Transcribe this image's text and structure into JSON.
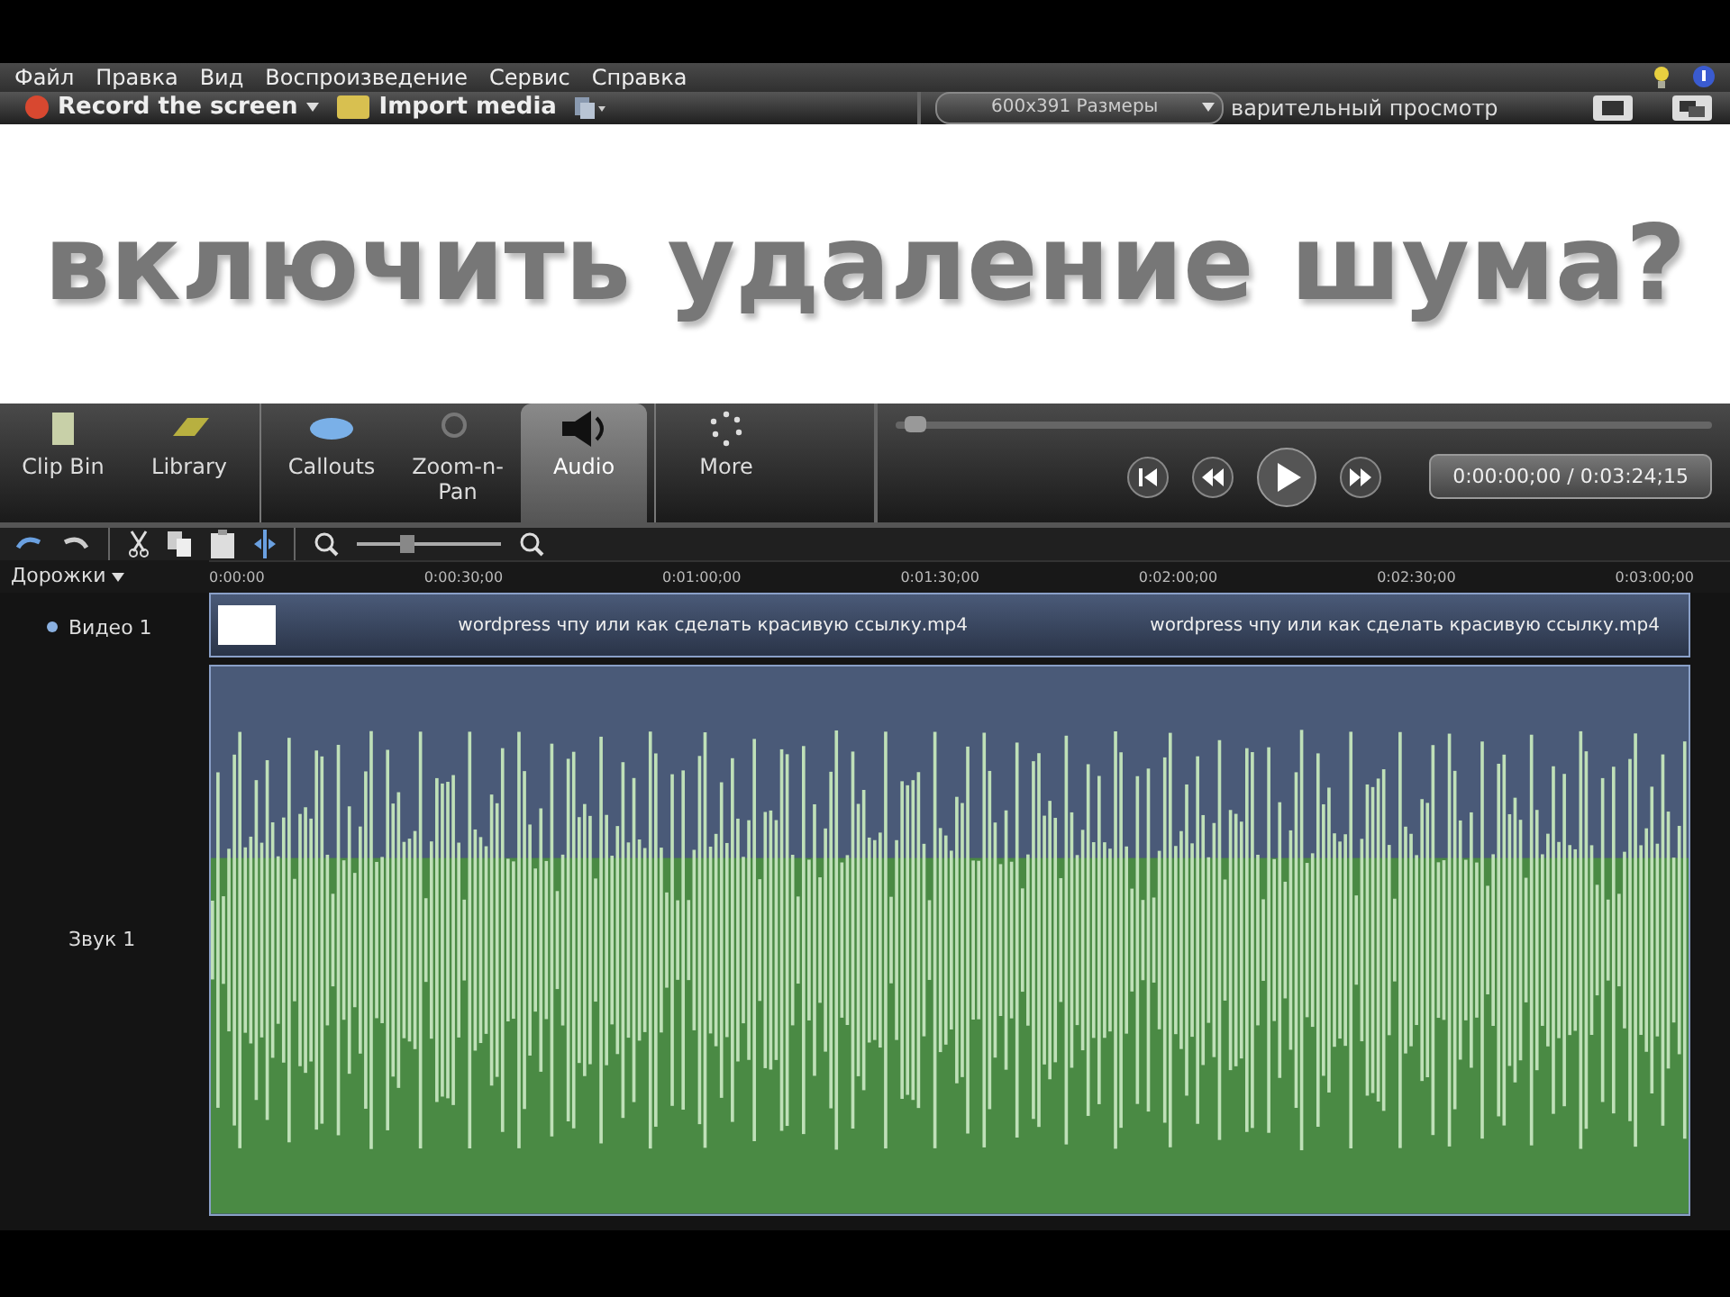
{
  "menu": [
    "Файл",
    "Правка",
    "Вид",
    "Воспроизведение",
    "Сервис",
    "Справка"
  ],
  "toolbar": {
    "record": "Record the screen",
    "import": "Import media"
  },
  "preview": {
    "size": "600x391 Размеры",
    "label": "варительный просмотр",
    "caption": "включить удаление шума?"
  },
  "tabs": [
    {
      "label": "Clip Bin",
      "selected": false
    },
    {
      "label": "Library",
      "selected": false
    },
    {
      "label": "Callouts",
      "selected": false
    },
    {
      "label": "Zoom-n-Pan",
      "selected": false
    },
    {
      "label": "Audio",
      "selected": true
    },
    {
      "label": "More",
      "selected": false
    }
  ],
  "player": {
    "level": 0.01,
    "timecode": "0:00:00;00 / 0:03:24;15"
  },
  "zoom_slider": {
    "level": 0.3
  },
  "timeline": {
    "tracks_label": "Дорожки",
    "ruler": [
      "0:00:00",
      "0:00:30;00",
      "0:01:00;00",
      "0:01:30;00",
      "0:02:00;00",
      "0:02:30;00",
      "0:03:00;00"
    ],
    "video_track": "Видео 1",
    "audio_track": "Звук 1",
    "clips": [
      "wordpress чпу или как сделать красивую ссылку.mp4",
      "wordpress чпу или как сделать красивую ссылку.mp4"
    ]
  }
}
